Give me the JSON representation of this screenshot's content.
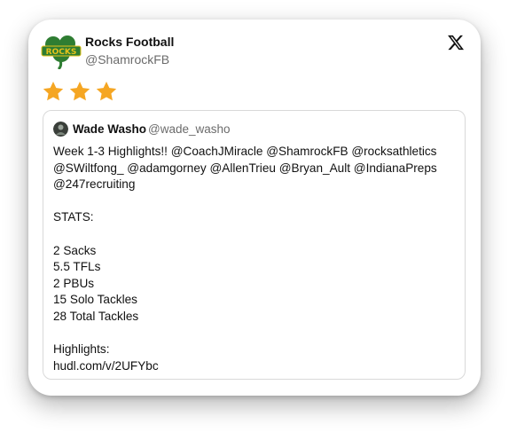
{
  "account": {
    "name": "Rocks Football",
    "handle": "@ShamrockFB",
    "logo_text": "ROCKS"
  },
  "rating": {
    "stars": 3,
    "star_color": "#f5a623"
  },
  "quoted_post": {
    "author_name": "Wade Washo",
    "author_handle": "@wade_washo",
    "lines": [
      "Week 1-3 Highlights!! @CoachJMiracle @ShamrockFB @rocksathletics",
      "@SWiltfong_ @adamgorney @AllenTrieu @Bryan_Ault @IndianaPreps",
      "@247recruiting",
      "",
      "STATS:",
      "",
      "2 Sacks",
      "5.5 TFLs",
      "2 PBUs",
      "15 Solo Tackles",
      "28 Total Tackles",
      "",
      "Highlights:",
      "hudl.com/v/2UFYbc"
    ]
  },
  "colors": {
    "shamrock_green": "#2e7d32",
    "logo_text": "#e6c21a",
    "text_primary": "#111111",
    "text_secondary": "#6b6b6b"
  },
  "icons": {
    "brand": "x-logo-icon",
    "rating": "star-icon",
    "logo": "shamrock-logo"
  }
}
